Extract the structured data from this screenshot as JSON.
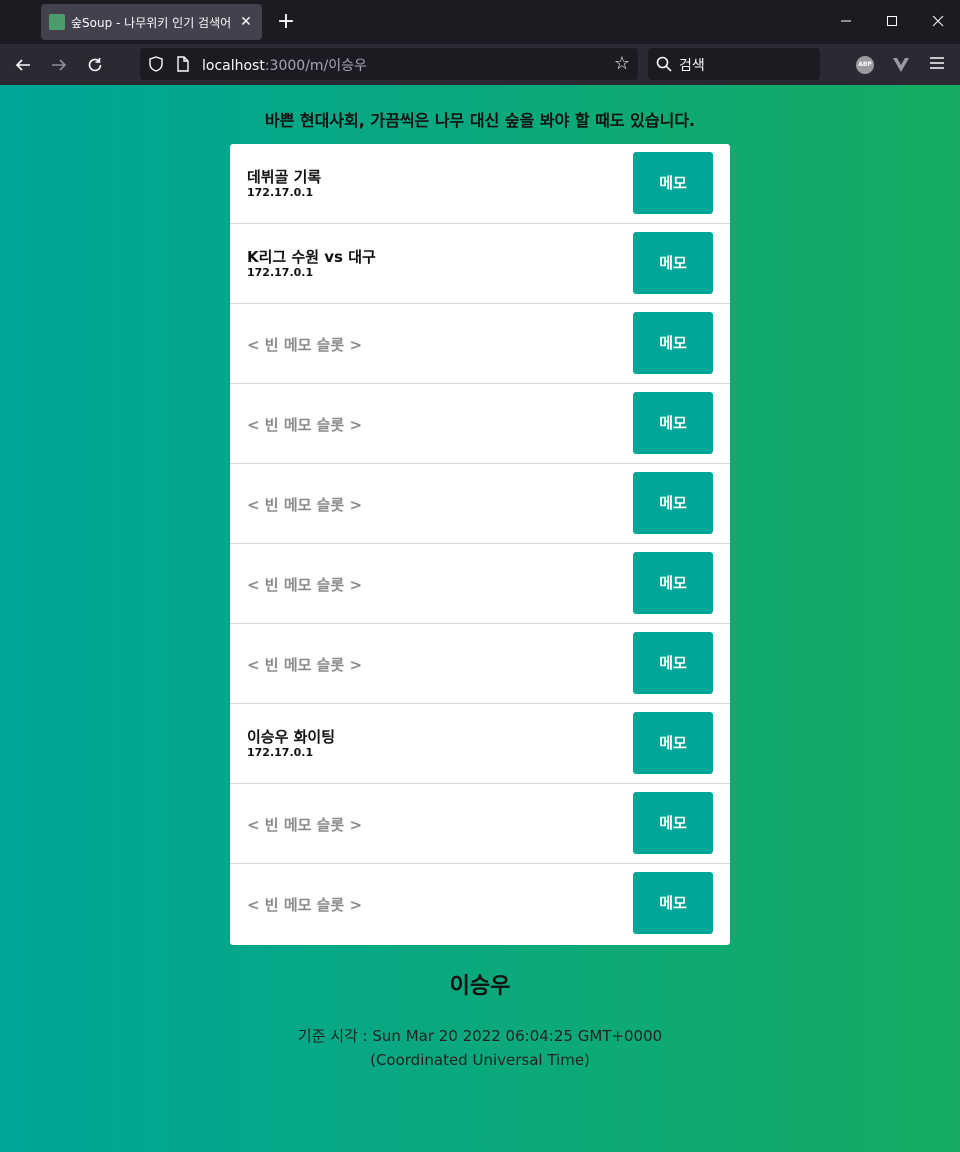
{
  "browser": {
    "tab_title": "숲Soup - 나무위키 인기 검색어",
    "new_tab_label": "+",
    "url_host": "localhost",
    "url_path": ":3000/m/이승우",
    "search_placeholder": "검색",
    "abp_label": "ABP"
  },
  "page": {
    "tagline": "바쁜 현대사회, 가끔씩은 나무 대신 숲을 봐야 할 때도 있습니다.",
    "memo_button_label": "메모",
    "memos": [
      {
        "text": "데뷔골 기록",
        "ip": "172.17.0.1",
        "empty": false
      },
      {
        "text": "K리그 수원 vs 대구",
        "ip": "172.17.0.1",
        "empty": false
      },
      {
        "text": "< 빈 메모 슬롯 >",
        "ip": "",
        "empty": true
      },
      {
        "text": "< 빈 메모 슬롯 >",
        "ip": "",
        "empty": true
      },
      {
        "text": "< 빈 메모 슬롯 >",
        "ip": "",
        "empty": true
      },
      {
        "text": "< 빈 메모 슬롯 >",
        "ip": "",
        "empty": true
      },
      {
        "text": "< 빈 메모 슬롯 >",
        "ip": "",
        "empty": true
      },
      {
        "text": "이승우 화이팅",
        "ip": "172.17.0.1",
        "empty": false
      },
      {
        "text": "< 빈 메모 슬롯 >",
        "ip": "",
        "empty": true
      },
      {
        "text": "< 빈 메모 슬롯 >",
        "ip": "",
        "empty": true
      }
    ],
    "username": "이승우",
    "base_time": "기준 시각 : Sun Mar 20 2022 06:04:25 GMT+0000 (Coordinated Universal Time)"
  },
  "colors": {
    "accent": "#00a698",
    "gradient_end": "#15ab62",
    "browser_bg": "#1c1b22",
    "toolbar_bg": "#2b2a33"
  }
}
